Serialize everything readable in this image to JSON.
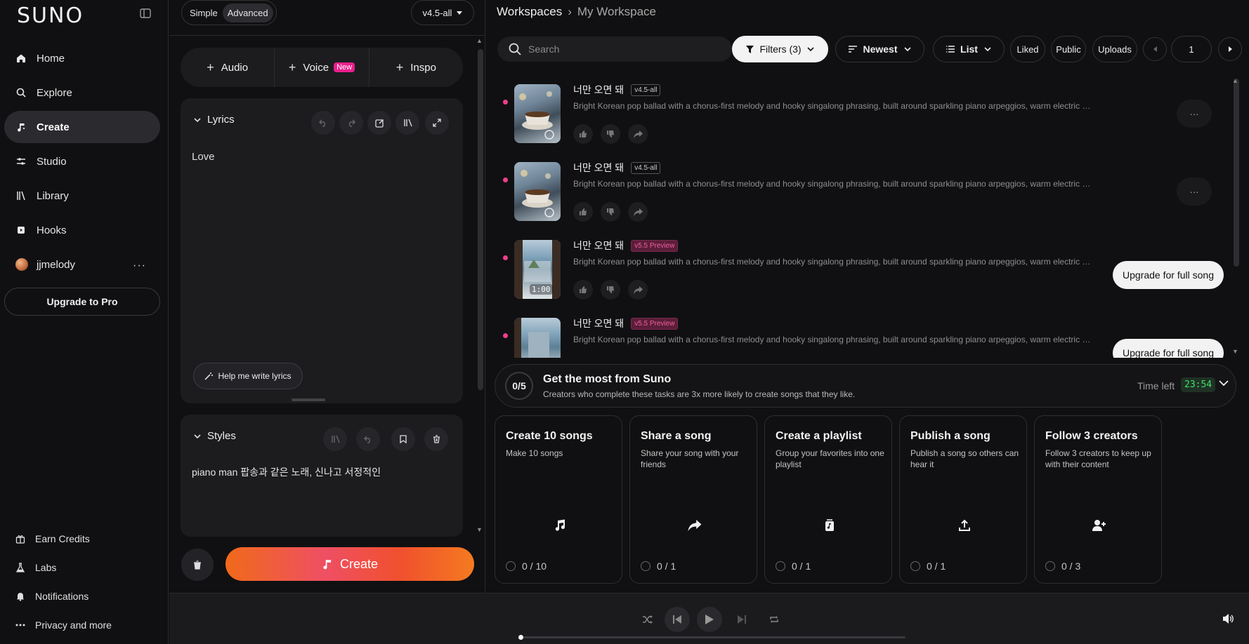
{
  "app": {
    "logo": "SUNO"
  },
  "sidebar": {
    "items": [
      {
        "label": "Home",
        "icon": "home-icon"
      },
      {
        "label": "Explore",
        "icon": "search-icon"
      },
      {
        "label": "Create",
        "icon": "music-note-icon",
        "active": true
      },
      {
        "label": "Studio",
        "icon": "sliders-icon"
      },
      {
        "label": "Library",
        "icon": "library-icon"
      },
      {
        "label": "Hooks",
        "icon": "hooks-icon"
      }
    ],
    "user": {
      "name": "jjmelody",
      "more": "···"
    },
    "upgrade": "Upgrade to Pro",
    "footer": [
      {
        "label": "Earn Credits",
        "icon": "gift-icon"
      },
      {
        "label": "Labs",
        "icon": "flask-icon"
      },
      {
        "label": "Notifications",
        "icon": "bell-icon"
      },
      {
        "label": "Privacy and more",
        "icon": "more-icon"
      }
    ]
  },
  "create_panel": {
    "mode": {
      "simple": "Simple",
      "advanced": "Advanced",
      "selected": "Advanced"
    },
    "model": "v4.5-all",
    "add_buttons": [
      {
        "label": "Audio"
      },
      {
        "label": "Voice",
        "badge": "New"
      },
      {
        "label": "Inspo"
      }
    ],
    "lyrics": {
      "heading": "Lyrics",
      "text": "Love",
      "help_button": "Help me write lyrics"
    },
    "styles": {
      "heading": "Styles",
      "text": "piano man 팝송과 같은 노래, 신나고 서정적인"
    },
    "create_button": "Create"
  },
  "main": {
    "breadcrumb": {
      "root": "Workspaces",
      "separator": "›",
      "current": "My Workspace"
    },
    "search": {
      "placeholder": "Search",
      "value": ""
    },
    "toolbar": {
      "filters": "Filters (3)",
      "sort": "Newest",
      "view": "List",
      "liked": "Liked",
      "public": "Public",
      "uploads": "Uploads",
      "page": "1"
    },
    "songs": [
      {
        "title": "너만 오면 돼",
        "version": "v4.5-all",
        "preview": false,
        "description": "Bright Korean pop ballad with a chorus-first melody and hooky singalong phrasing, built around sparkling piano arpeggios, warm electric bass, c...",
        "more": "···",
        "duration": ""
      },
      {
        "title": "너만 오면 돼",
        "version": "v4.5-all",
        "preview": false,
        "description": "Bright Korean pop ballad with a chorus-first melody and hooky singalong phrasing, built around sparkling piano arpeggios, warm electric bass, c...",
        "more": "···",
        "duration": ""
      },
      {
        "title": "너만 오면 돼",
        "version": "v5.5 Preview",
        "preview": true,
        "description": "Bright Korean pop ballad with a chorus-first melody and hooky singalong phrasing, built around sparkling piano arpeggios, warm electric bass, ...",
        "upgrade": "Upgrade for full song",
        "duration": "1:00"
      },
      {
        "title": "너만 오면 돼",
        "version": "v5.5 Preview",
        "preview": true,
        "description": "Bright Korean pop ballad with a chorus-first melody and hooky singalong phrasing, built around sparkling piano arpeggios, warm electric bass, ...",
        "upgrade": "Upgrade for full song",
        "duration": ""
      }
    ],
    "onboarding": {
      "progress": "0/5",
      "title": "Get the most from Suno",
      "subtitle": "Creators who complete these tasks are 3x more likely to create songs that they like.",
      "time_left_label": "Time left",
      "timer": "23:54",
      "tasks": [
        {
          "title": "Create 10 songs",
          "description": "Make 10 songs",
          "progress": "0 / 10",
          "icon": "music-note-icon"
        },
        {
          "title": "Share a song",
          "description": "Share your song with your friends",
          "progress": "0 / 1",
          "icon": "share-icon"
        },
        {
          "title": "Create a playlist",
          "description": "Group your favorites into one playlist",
          "progress": "0 / 1",
          "icon": "playlist-icon"
        },
        {
          "title": "Publish a song",
          "description": "Publish a song so others can hear it",
          "progress": "0 / 1",
          "icon": "upload-icon"
        },
        {
          "title": "Follow 3 creators",
          "description": "Follow 3 creators to keep up with their content",
          "progress": "0 / 3",
          "icon": "add-user-icon"
        }
      ]
    }
  },
  "colors": {
    "accent_pink": "#e91e8c",
    "timer_green": "#3ee06b",
    "create_gradient_start": "#f06a1a",
    "create_gradient_end": "#f57a20"
  }
}
